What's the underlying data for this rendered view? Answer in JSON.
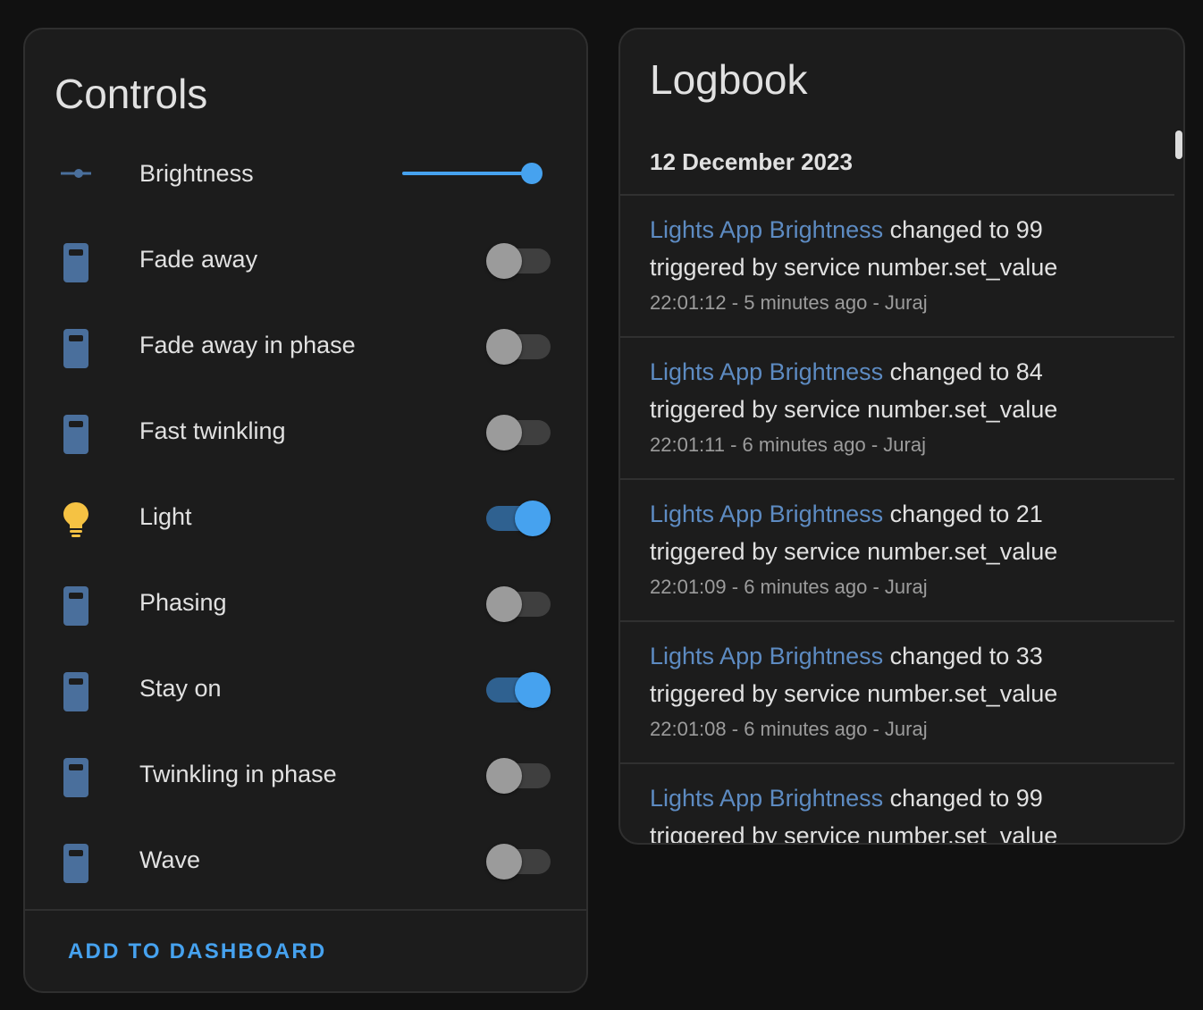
{
  "colors": {
    "background": "#111111",
    "card": "#1c1c1c",
    "accent": "#46a2ef",
    "entity_link": "#5d8bc2",
    "light_icon": "#f5c243",
    "switch_icon": "#4a6f9c"
  },
  "controls": {
    "title": "Controls",
    "brightness": {
      "label": "Brightness",
      "icon": "slider-icon",
      "value_fraction": 1.0
    },
    "switches": [
      {
        "label": "Fade away",
        "icon": "switch-icon",
        "on": false
      },
      {
        "label": "Fade away in phase",
        "icon": "switch-icon",
        "on": false
      },
      {
        "label": "Fast twinkling",
        "icon": "switch-icon",
        "on": false
      },
      {
        "label": "Light",
        "icon": "lightbulb-icon",
        "on": true
      },
      {
        "label": "Phasing",
        "icon": "switch-icon",
        "on": false
      },
      {
        "label": "Stay on",
        "icon": "switch-icon",
        "on": true
      },
      {
        "label": "Twinkling in phase",
        "icon": "switch-icon",
        "on": false
      },
      {
        "label": "Wave",
        "icon": "switch-icon",
        "on": false
      }
    ],
    "add_to_dashboard": "ADD TO DASHBOARD"
  },
  "logbook": {
    "title": "Logbook",
    "date": "12 December 2023",
    "entries": [
      {
        "entity": "Lights App Brightness",
        "message": " changed to 99",
        "trigger": "triggered by service number.set_value",
        "meta": "22:01:12 - 5 minutes ago - Juraj"
      },
      {
        "entity": "Lights App Brightness",
        "message": " changed to 84",
        "trigger": "triggered by service number.set_value",
        "meta": "22:01:11 - 6 minutes ago - Juraj"
      },
      {
        "entity": "Lights App Brightness",
        "message": " changed to 21",
        "trigger": "triggered by service number.set_value",
        "meta": "22:01:09 - 6 minutes ago - Juraj"
      },
      {
        "entity": "Lights App Brightness",
        "message": " changed to 33",
        "trigger": "triggered by service number.set_value",
        "meta": "22:01:08 - 6 minutes ago - Juraj"
      },
      {
        "entity": "Lights App Brightness",
        "message": " changed to 99",
        "trigger": "triggered by service number.set_value",
        "meta": ""
      }
    ]
  }
}
